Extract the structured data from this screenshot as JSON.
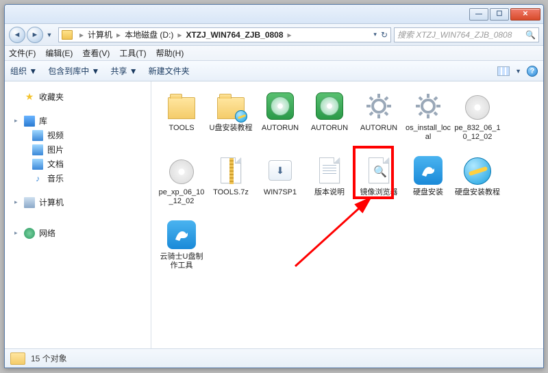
{
  "window_controls": {
    "min": "—",
    "max": "☐",
    "close": "✕"
  },
  "nav": {
    "back": "◄",
    "forward": "►",
    "dropdown": "▼"
  },
  "breadcrumbs": {
    "root": "计算机",
    "drive": "本地磁盘 (D:)",
    "folder": "XTZJ_WIN764_ZJB_0808",
    "refresh": "↻"
  },
  "search": {
    "placeholder": "搜索 XTZJ_WIN764_ZJB_0808",
    "icon": "🔍"
  },
  "menubar": {
    "file": "文件(F)",
    "edit": "编辑(E)",
    "view": "查看(V)",
    "tools": "工具(T)",
    "help": "帮助(H)"
  },
  "toolbar": {
    "organize": "组织 ▼",
    "include": "包含到库中 ▼",
    "share": "共享 ▼",
    "newfolder": "新建文件夹",
    "help": "?"
  },
  "sidebar": {
    "favorites": "收藏夹",
    "libraries": "库",
    "lib_items": {
      "video": "视频",
      "pictures": "图片",
      "documents": "文档",
      "music": "音乐"
    },
    "computer": "计算机",
    "network": "网络"
  },
  "items": {
    "row1": [
      {
        "label": "TOOLS"
      },
      {
        "label": "U盘安装教程"
      },
      {
        "label": "AUTORUN"
      },
      {
        "label": "AUTORUN"
      },
      {
        "label": "AUTORUN"
      },
      {
        "label": "os_install_local"
      },
      {
        "label": "pe_832_06_10_12_02"
      },
      {
        "label": "pe_xp_06_10_12_02"
      }
    ],
    "row2": [
      {
        "label": "TOOLS.7z"
      },
      {
        "label": "WIN7SP1"
      },
      {
        "label": "版本说明"
      },
      {
        "label": "镜像浏览器"
      },
      {
        "label": "硬盘安装"
      },
      {
        "label": "硬盘安装教程"
      },
      {
        "label": "云骑士U盘制作工具"
      }
    ]
  },
  "status": {
    "count": "15 个对象"
  }
}
